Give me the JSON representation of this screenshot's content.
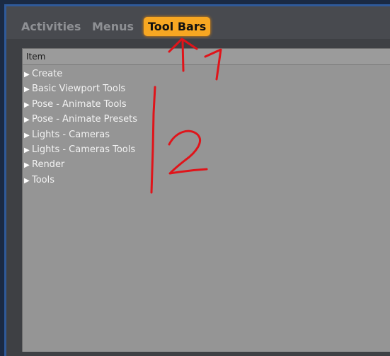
{
  "tabs": [
    {
      "label": "Activities",
      "active": false
    },
    {
      "label": "Menus",
      "active": false
    },
    {
      "label": "Tool Bars",
      "active": true
    }
  ],
  "list": {
    "column_header": "Item",
    "items": [
      "Create",
      "Basic Viewport Tools",
      "Pose - Animate Tools",
      "Pose - Animate Presets",
      "Lights - Cameras",
      "Lights - Cameras Tools",
      "Render",
      "Tools"
    ]
  },
  "annotations": {
    "marker_1": "1",
    "marker_2": "2",
    "color": "#e0141a"
  },
  "colors": {
    "active_tab": "#f7a722",
    "panel": "#959595",
    "frame_border": "#2f5a9a"
  }
}
